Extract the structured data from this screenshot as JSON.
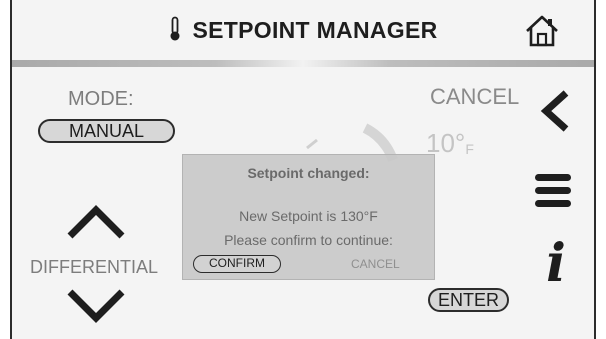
{
  "header": {
    "title": "SETPOINT MANAGER",
    "thermometer_icon": "thermometer-icon",
    "home_icon": "home-icon"
  },
  "mode": {
    "label": "MODE:",
    "value": "MANUAL"
  },
  "top_right": {
    "cancel_label": "CANCEL",
    "back_icon": "chevron-left-icon"
  },
  "temperature": {
    "value": "10°",
    "unit": "F"
  },
  "side_icons": {
    "menu_icon": "hamburger-menu-icon",
    "info_icon": "info-icon",
    "info_glyph": "i"
  },
  "differential": {
    "label": "DIFFERENTIAL",
    "up_icon": "chevron-up-icon",
    "down_icon": "chevron-down-icon"
  },
  "enter_label": "ENTER",
  "dialog": {
    "title": "Setpoint changed:",
    "message_line1": "New Setpoint is 130°F",
    "message_line2": "Please confirm to continue:",
    "confirm_label": "CONFIRM",
    "cancel_label": "CANCEL"
  },
  "colors": {
    "text_dark": "#1e1e1e",
    "text_muted": "#7d7d7d",
    "dialog_bg": "#c8c8c8",
    "screen_bg": "#f4f4f4"
  }
}
